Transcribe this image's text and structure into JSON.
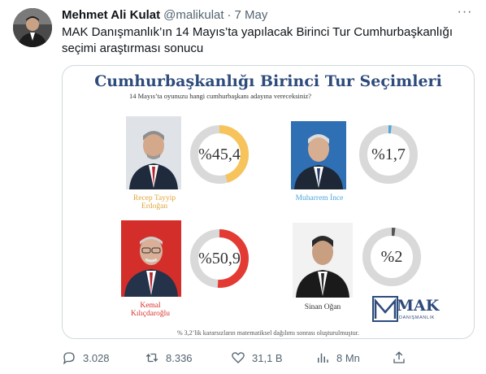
{
  "tweet": {
    "author_name": "Mehmet Ali Kulat",
    "handle": "@malikulat",
    "separator": "·",
    "date": "7 May",
    "more_label": "···",
    "text": "MAK Danışmanlık’ın 14 Mayıs’ta yapılacak Birinci Tur Cumhurbaşkanlığı seçimi araştırması sonucu"
  },
  "media": {
    "title": "Cumhurbaşkanlığı Birinci Tur Seçimleri",
    "subtitle": "14 Mayıs’ta oyunuzu hangi cumhurbaşkanı adayına vereceksiniz?",
    "footnote": "% 3,2’lik kararsızların matematiksel dağılımı sonrası oluşturulmuştur.",
    "logo_text": "MAK",
    "logo_sub": "DANIŞMANLIK",
    "ring_track_color": "#d9d9d9",
    "candidates": [
      {
        "name_line1": "Recep Tayyip",
        "name_line2": "Erdoğan",
        "label": "%45,4",
        "value": 45.4,
        "color": "#f7c35b",
        "name_color": "#e0a63a"
      },
      {
        "name_line1": "Muharrem İnce",
        "name_line2": "",
        "label": "%1,7",
        "value": 1.7,
        "color": "#4fa6dd",
        "name_color": "#4fa6dd"
      },
      {
        "name_line1": "Kemal",
        "name_line2": "Kılıçdaroğlu",
        "label": "%50,9",
        "value": 50.9,
        "color": "#e33b33",
        "name_color": "#d8322c"
      },
      {
        "name_line1": "Sinan Oğan",
        "name_line2": "",
        "label": "%2",
        "value": 2,
        "color": "#555555",
        "name_color": "#333333"
      }
    ]
  },
  "actions": {
    "replies": "3.028",
    "retweets": "8.336",
    "likes": "31,1 B",
    "views": "8 Mn"
  }
}
